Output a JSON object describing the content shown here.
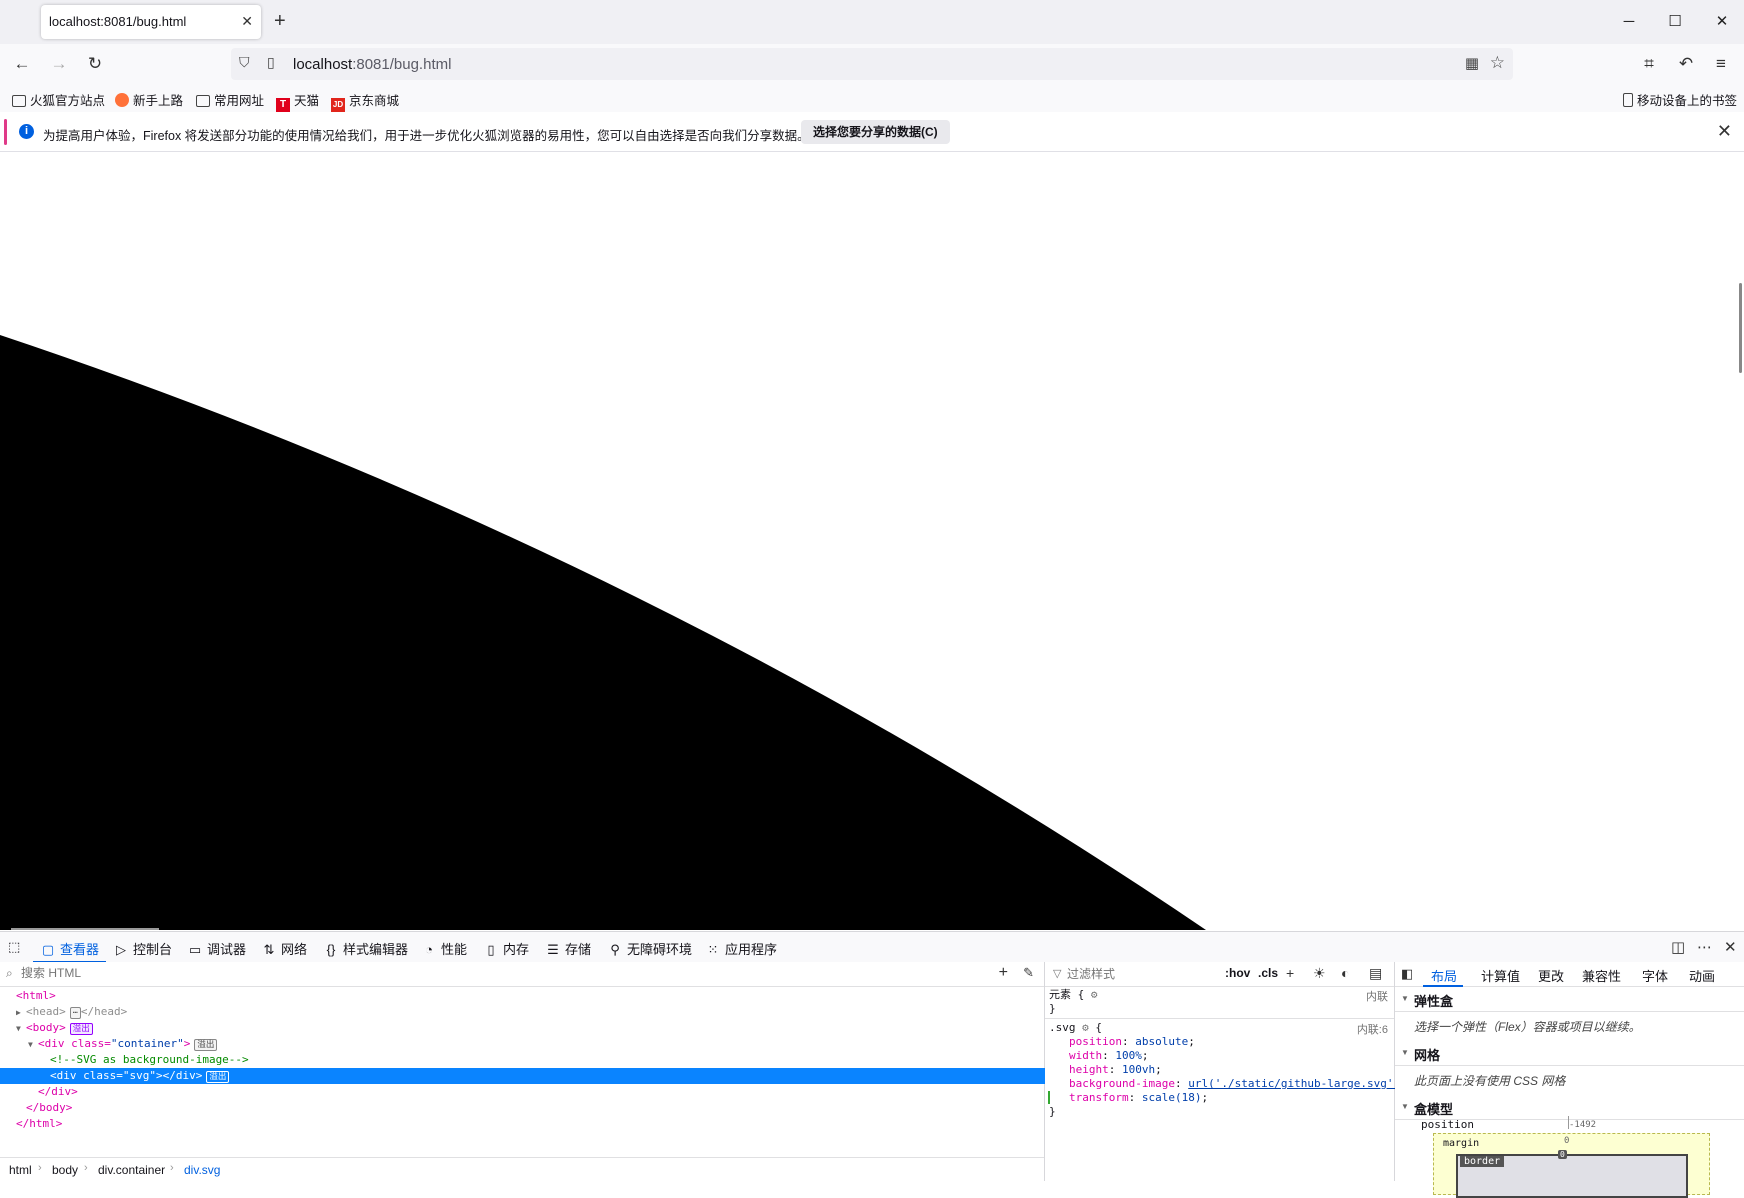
{
  "tab": {
    "title": "localhost:8081/bug.html"
  },
  "urlbar": {
    "host": "localhost",
    "path": ":8081/bug.html"
  },
  "bookmarks": [
    {
      "label": "火狐官方站点",
      "icon": "folder-icon"
    },
    {
      "label": "新手上路",
      "icon": "firefox-icon"
    },
    {
      "label": "常用网址",
      "icon": "folder-icon"
    },
    {
      "label": "天猫",
      "icon": "tmall-icon",
      "glyph": "T"
    },
    {
      "label": "京东商城",
      "icon": "jd-icon",
      "glyph": "JD"
    }
  ],
  "mobile_bookmarks": "移动设备上的书签",
  "notification": {
    "text": "为提高用户体验，Firefox 将发送部分功能的使用情况给我们，用于进一步优化火狐浏览器的易用性，您可以自由选择是否向我们分享数据。",
    "button": "选择您要分享的数据(C)"
  },
  "devtools": {
    "tabs": [
      {
        "label": "查看器",
        "icon": "inspector-icon"
      },
      {
        "label": "控制台",
        "icon": "console-icon"
      },
      {
        "label": "调试器",
        "icon": "debugger-icon"
      },
      {
        "label": "网络",
        "icon": "network-icon"
      },
      {
        "label": "样式编辑器",
        "icon": "style-editor-icon"
      },
      {
        "label": "性能",
        "icon": "performance-icon"
      },
      {
        "label": "内存",
        "icon": "memory-icon"
      },
      {
        "label": "存储",
        "icon": "storage-icon"
      },
      {
        "label": "无障碍环境",
        "icon": "accessibility-icon"
      },
      {
        "label": "应用程序",
        "icon": "application-icon"
      }
    ]
  },
  "markup": {
    "search_placeholder": "搜索 HTML",
    "nodes": {
      "html_open": "<html>",
      "head_open": "<head>",
      "head_close": "</head>",
      "body_open": "<body>",
      "body_badge": "溢出",
      "container_tag": "<div",
      "container_attr": " class=",
      "container_val": "\"container\"",
      "container_end": ">",
      "container_badge": "溢出",
      "comment": "<!--SVG as background-image-->",
      "svg_tag": "<div",
      "svg_attr": " class=",
      "svg_val": "\"svg\"",
      "svg_end": "></div>",
      "svg_badge": "溢出",
      "div_close": "</div>",
      "body_close": "</body>",
      "html_close": "</html>"
    },
    "breadcrumbs": [
      "html",
      "body",
      "div.container",
      "div.svg"
    ]
  },
  "rules": {
    "filter_placeholder": "过滤样式",
    "hov": ":hov",
    "cls": ".cls",
    "element_selector": "元素 {",
    "element_close": "}",
    "element_source": "内联",
    "svg_selector": ".svg",
    "svg_brace": "{",
    "svg_source": "内联:6",
    "declarations": [
      {
        "prop": "position",
        "value": "absolute"
      },
      {
        "prop": "width",
        "value": "100%"
      },
      {
        "prop": "height",
        "value": "100vh"
      },
      {
        "prop": "background-image",
        "value": "url('./static/github-large.svg')"
      },
      {
        "prop": "transform",
        "value": "scale(18)"
      }
    ],
    "svg_close": "}"
  },
  "layout_panel": {
    "tabs": [
      "布局",
      "计算值",
      "更改",
      "兼容性",
      "字体",
      "动画"
    ],
    "flexbox": {
      "title": "弹性盒",
      "body": "选择一个弹性（Flex）容器或项目以继续。"
    },
    "grid": {
      "title": "网格",
      "body": "此页面上没有使用 CSS 网格"
    },
    "boxmodel": {
      "title": "盒模型",
      "position_label": "position",
      "position_top": "-1492",
      "margin_label": "margin",
      "margin_top": "0",
      "border_label": "border",
      "border_top": "0"
    }
  }
}
